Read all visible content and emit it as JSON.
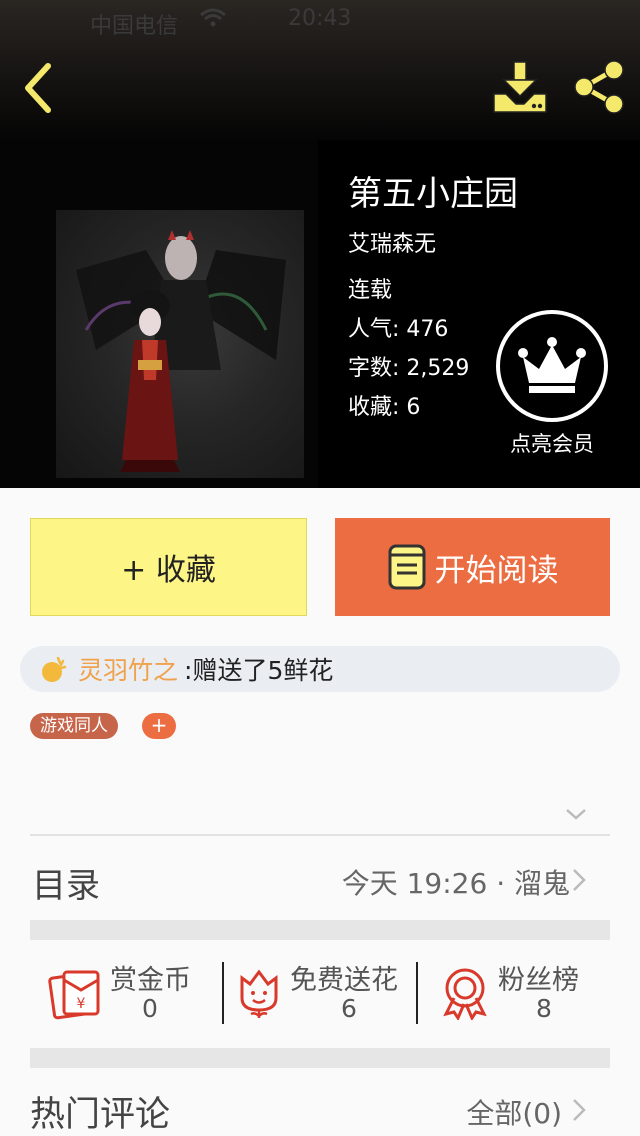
{
  "status_bar": {
    "carrier": "中国电信",
    "time": "20:43"
  },
  "header": {
    "back_icon": "chevron-left-icon",
    "download_icon": "download-icon",
    "share_icon": "share-icon",
    "icon_color": "#f4e96a"
  },
  "book": {
    "title": "第五小庄园",
    "author": "艾瑞森无",
    "status": "连载",
    "stats": [
      {
        "label": "人气:",
        "value": "476"
      },
      {
        "label": "字数:",
        "value": "2,529"
      },
      {
        "label": "收藏:",
        "value": "6"
      }
    ]
  },
  "vip": {
    "icon": "crown-icon",
    "label": "点亮会员"
  },
  "actions": {
    "favorite_label": "+ 收藏",
    "read_label": "开始阅读",
    "favorite_color": "#fdf686",
    "read_color": "#ec6d42"
  },
  "gift_bar": {
    "user": "灵羽竹之",
    "text": ":赠送了5鲜花"
  },
  "tags": {
    "items": [
      "游戏同人"
    ],
    "add_label": "+"
  },
  "toc": {
    "title": "目录",
    "latest": "今天 19:26 · 溜鬼"
  },
  "rewards": [
    {
      "icon": "red-envelope-icon",
      "label": "赏金币",
      "value": "0"
    },
    {
      "icon": "flower-icon",
      "label": "免费送花",
      "value": "6"
    },
    {
      "icon": "medal-icon",
      "label": "粉丝榜",
      "value": "8"
    }
  ],
  "comments": {
    "title": "热门评论",
    "all_label": "全部(0)"
  }
}
